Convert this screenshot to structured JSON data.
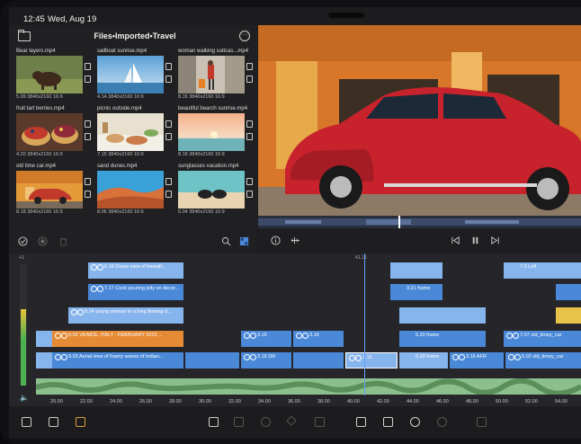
{
  "status": {
    "time": "12:45",
    "date": "Wed, Aug 19"
  },
  "browser": {
    "title": "Files•Imported•Travel",
    "clips": [
      {
        "name": "Bear layers.mp4",
        "meta": "5.09 3840x2160 16:9",
        "thumb": "bear"
      },
      {
        "name": "sailboat sunrise.mp4",
        "meta": "4.14 3840x2160 16:9",
        "thumb": "sail"
      },
      {
        "name": "woman walking suitcas...mp4",
        "meta": "8.16 3840x2160 16:9",
        "thumb": "woman"
      },
      {
        "name": "fruit tart berries.mp4",
        "meta": "4.20 3840x2160 16:9",
        "thumb": "tart"
      },
      {
        "name": "picnic outside.mp4",
        "meta": "7.15 3840x2160 16:9",
        "thumb": "picnic"
      },
      {
        "name": "beautiful bearch sunrise.mp4",
        "meta": "8.16 3840x2160 16:9",
        "thumb": "beach"
      },
      {
        "name": "old time car.mp4",
        "meta": "8.18 3840x2160 16:9",
        "thumb": "car"
      },
      {
        "name": "sand dunes.mp4",
        "meta": "8.06 3840x2160 16:9",
        "thumb": "dunes"
      },
      {
        "name": "sunglasses vacation.mp4",
        "meta": "6.04 3840x2160 16:9",
        "thumb": "sunglasses"
      }
    ]
  },
  "timeline": {
    "playhead_time": "41.13",
    "meter_top": "+1",
    "clips": [
      {
        "label": "6.18 Drone view of beautif...",
        "style": "light"
      },
      {
        "label": "7.17 Cook pouring jelly on decor...",
        "style": "blue"
      },
      {
        "label": "8.14 young woman in a long flowing d...",
        "style": "light"
      },
      {
        "label": "9.03 VENICE, ITALY - FEBRUARY 2015 ...",
        "style": "orange"
      },
      {
        "label": "9.03 Aerial view of foamy waves of Indian...",
        "style": "blue"
      },
      {
        "label": "3.16",
        "style": "blue"
      },
      {
        "label": "3.16 DR",
        "style": "blue"
      },
      {
        "label": "3.16",
        "style": "blue"
      },
      {
        "label": "3.15",
        "style": "blue"
      },
      {
        "label": "3.21 frame",
        "style": "blue"
      },
      {
        "label": "5.20 frame",
        "style": "blue"
      },
      {
        "label": "5.20 frame",
        "style": "light"
      },
      {
        "label": "3.16 AFR",
        "style": "blue"
      },
      {
        "label": "7.0 Left",
        "style": "light"
      },
      {
        "label": "7.07 old_timey_car",
        "style": "blue"
      },
      {
        "label": "5.02 old_timey_car",
        "style": "blue"
      }
    ],
    "ticks": [
      "20.00",
      "22.00",
      "24.00",
      "26.00",
      "28.00",
      "30.00",
      "32.00",
      "34.00",
      "36.00",
      "38.00",
      "40.00",
      "42.00",
      "44.00",
      "46.00",
      "48.00",
      "50.00",
      "52.00",
      "54.00"
    ]
  }
}
